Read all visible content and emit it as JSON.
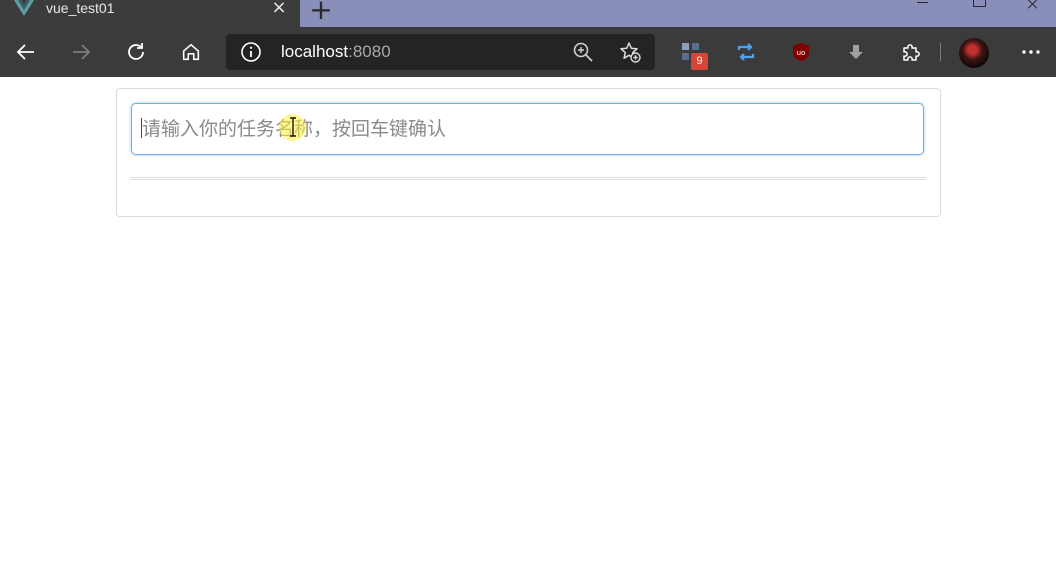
{
  "browser": {
    "tab": {
      "title": "vue_test01",
      "favicon": "vue-logo-icon",
      "close_glyph": "×"
    },
    "new_tab_glyph": "+",
    "address": {
      "host": "localhost",
      "port": ":8080"
    },
    "extension_badge": "9"
  },
  "colors": {
    "tab_strip": "#8a8fb9",
    "toolbar": "#3b3b3b",
    "input_border": "#72aee4",
    "badge": "#d64535"
  },
  "app": {
    "todo_input": {
      "value": "",
      "placeholder": "请输入你的任务名称，按回车键确认"
    }
  }
}
